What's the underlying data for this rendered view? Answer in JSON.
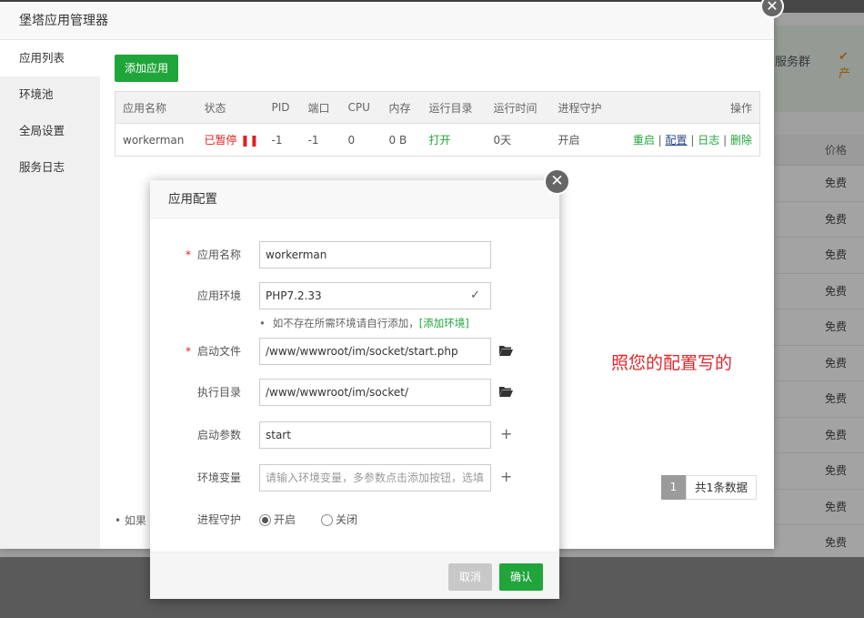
{
  "background": {
    "service_group": "服务群",
    "check_mark": "✔ 产",
    "price_header": "价格",
    "price_rows": [
      "免费",
      "免费",
      "免费",
      "免费",
      "免费",
      "免费",
      "免费",
      "免费",
      "免费",
      "免费",
      "免费"
    ]
  },
  "manager": {
    "title": "堡塔应用管理器",
    "close_label": "✕",
    "sidebar": [
      {
        "label": "应用列表",
        "active": true
      },
      {
        "label": "环境池",
        "active": false
      },
      {
        "label": "全局设置",
        "active": false
      },
      {
        "label": "服务日志",
        "active": false
      }
    ],
    "add_button": "添加应用",
    "table": {
      "headers": [
        "应用名称",
        "状态",
        "PID",
        "端口",
        "CPU",
        "内存",
        "运行目录",
        "运行时间",
        "进程守护",
        "操作"
      ],
      "row": {
        "name": "workerman",
        "status": "已暂停",
        "pid": "-1",
        "port": "-1",
        "cpu": "0",
        "memory": "0 B",
        "dir": "打开",
        "runtime": "0天",
        "guard": "开启",
        "actions": [
          "重启",
          "配置",
          "日志",
          "删除"
        ]
      }
    },
    "pager": {
      "page": "1",
      "total": "共1条数据"
    },
    "note": "如果"
  },
  "dialog": {
    "title": "应用配置",
    "close_label": "✕",
    "fields": {
      "name": {
        "label": "应用名称",
        "value": "workerman",
        "required": true
      },
      "env": {
        "label": "应用环境",
        "value": "PHP7.2.33"
      },
      "hint": {
        "text": "如不存在所需环境请自行添加，",
        "link": "[添加环境]"
      },
      "start_file": {
        "label": "启动文件",
        "value": "/www/wwwroot/im/socket/start.php",
        "required": true
      },
      "exec_dir": {
        "label": "执行目录",
        "value": "/www/wwwroot/im/socket/"
      },
      "start_args": {
        "label": "启动参数",
        "value": "start"
      },
      "env_vars": {
        "label": "环境变量",
        "placeholder": "请输入环境变量，多参数点击添加按钮，选填"
      },
      "guard": {
        "label": "进程守护",
        "options": [
          "开启",
          "关闭"
        ],
        "selected": "开启"
      }
    },
    "cancel": "取消",
    "confirm": "确认"
  },
  "annotation": "照您的配置写的",
  "colors": {
    "accent": "#20a53a",
    "danger": "#e02020"
  }
}
